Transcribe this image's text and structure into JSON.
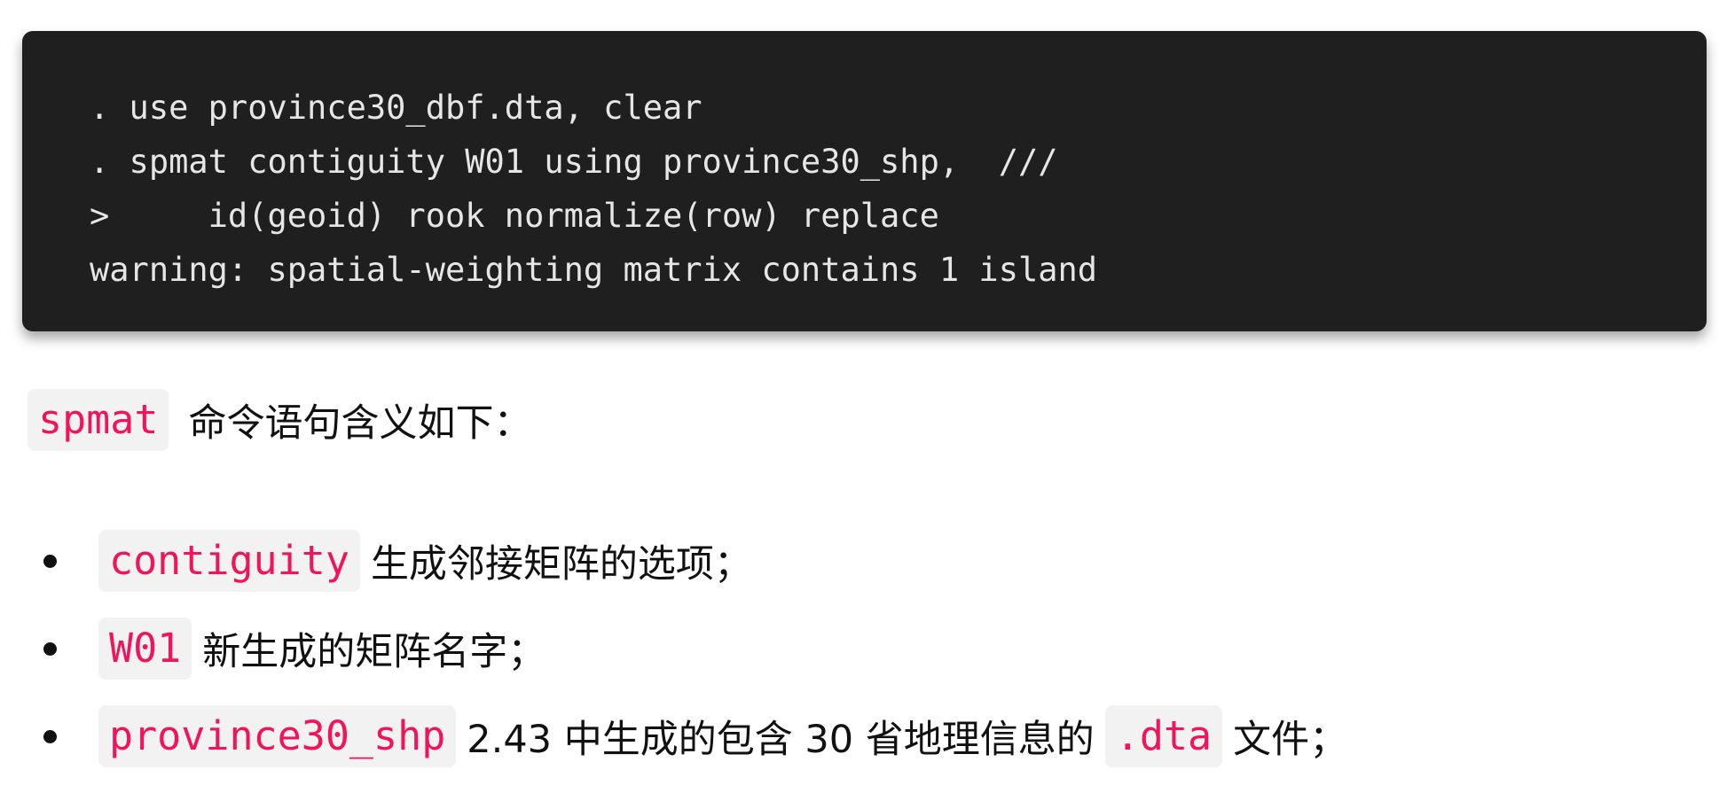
{
  "code_block": {
    "lines": [
      ". use province30_dbf.dta, clear",
      ". spmat contiguity W01 using province30_shp,  ///",
      ">     id(geoid) rook normalize(row) replace",
      "warning: spatial-weighting matrix contains 1 island"
    ]
  },
  "intro": {
    "code": "spmat",
    "text": "命令语句含义如下："
  },
  "bullets": [
    {
      "code": "contiguity",
      "text": "生成邻接矩阵的选项；"
    },
    {
      "code": "W01",
      "text": "新生成的矩阵名字；"
    },
    {
      "code": "province30_shp",
      "text_before": "2.43 中生成的包含 30 省地理信息的",
      "code2": ".dta",
      "text_after": "文件；"
    }
  ],
  "colors": {
    "code_bg": "#1f1f1f",
    "inline_code": "#f0145a",
    "chip_bg": "#f2f2f2"
  }
}
